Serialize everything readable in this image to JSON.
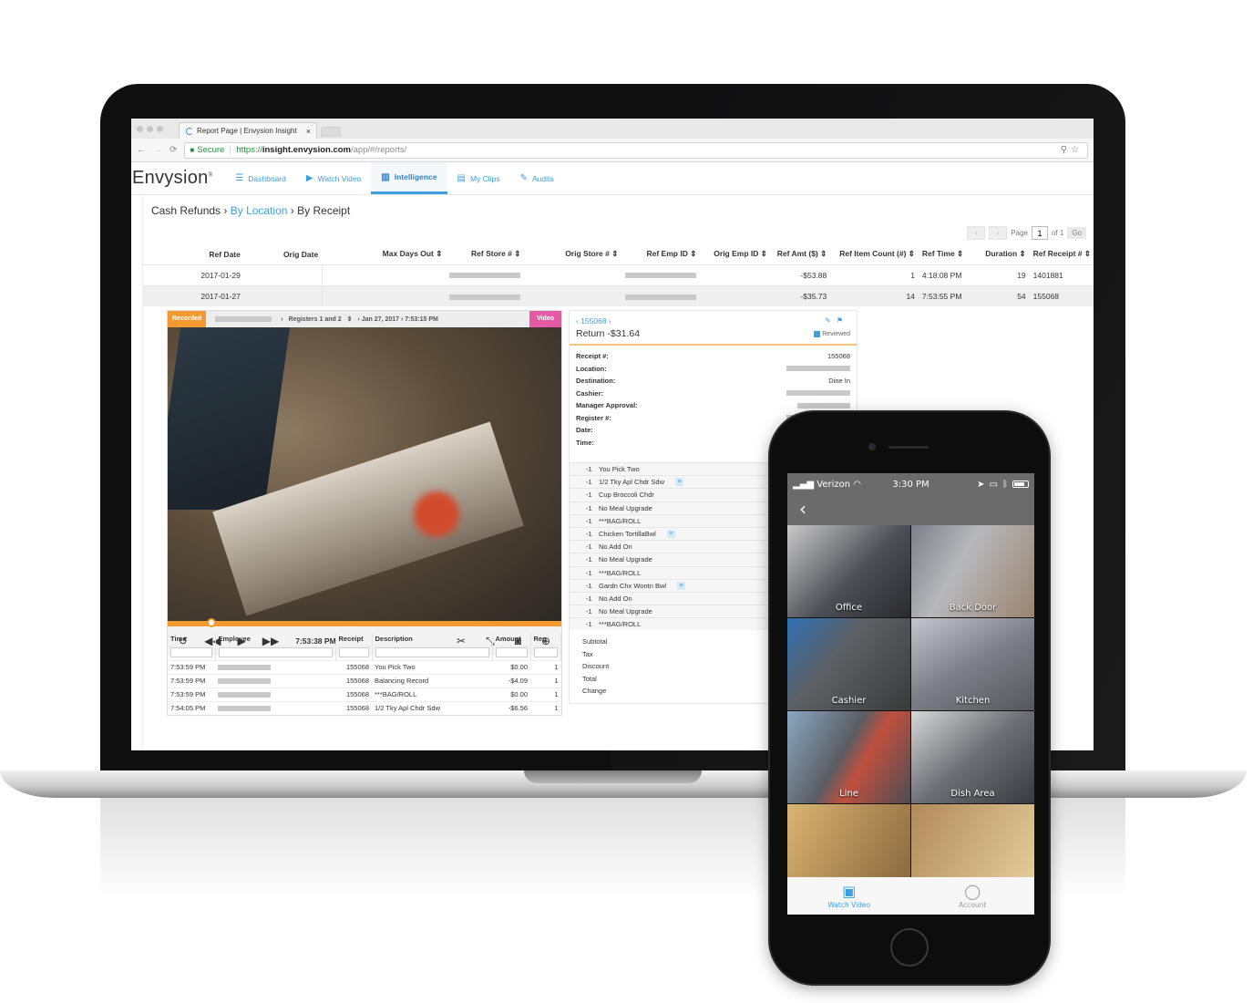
{
  "browser": {
    "tab_title": "Report Page | Envysion Insight",
    "secure_label": "Secure",
    "url_scheme": "https://",
    "url_host": "insight.envysion.com",
    "url_path": "/app/#/reports/"
  },
  "app": {
    "logo": "Envysion",
    "nav": [
      {
        "label": "Dashboard",
        "icon": "dashboard-icon"
      },
      {
        "label": "Watch Video",
        "icon": "play-circle-icon"
      },
      {
        "label": "Intelligence",
        "icon": "bar-chart-icon",
        "active": true
      },
      {
        "label": "My Clips",
        "icon": "film-icon"
      },
      {
        "label": "Audits",
        "icon": "edit-icon"
      }
    ]
  },
  "breadcrumb": {
    "root": "Cash Refunds",
    "sep": "›",
    "mid": "By Location",
    "current": "By Receipt"
  },
  "pager": {
    "page_label": "Page",
    "page": "1",
    "of": "of 1",
    "go": "Go"
  },
  "report_table": {
    "columns": [
      "Ref Date",
      "Orig Date",
      "Max Days Out",
      "Ref Store #",
      "Orig Store #",
      "Ref Emp ID",
      "Orig Emp ID",
      "Ref Amt ($)",
      "Ref Item Count (#)",
      "Ref Time",
      "Duration",
      "Ref Receipt #"
    ],
    "rows": [
      {
        "ref_date": "2017-01-29",
        "ref_amt": "-$53.88",
        "count": "1",
        "ref_time": "4:18:08 PM",
        "duration": "19",
        "receipt": "1401881"
      },
      {
        "ref_date": "2017-01-27",
        "ref_amt": "-$35.73",
        "count": "14",
        "ref_time": "7:53:55 PM",
        "duration": "54",
        "receipt": "155068"
      }
    ]
  },
  "video": {
    "recorded_badge": "Recorded",
    "registers": "Registers 1 and 2",
    "datetime": "Jan 27, 2017 › 7:53:15 PM",
    "video_badge": "Video",
    "playback_time": "7:53:38 PM",
    "progress": 0.1
  },
  "transactions": {
    "columns": [
      "Time",
      "Employee",
      "Receipt",
      "Description",
      "Amount",
      "Reg"
    ],
    "rows": [
      {
        "time": "7:53:59 PM",
        "receipt": "155068",
        "desc": "You Pick Two",
        "amount": "$0.00",
        "reg": "1"
      },
      {
        "time": "7:53:59 PM",
        "receipt": "155068",
        "desc": "Balancing Record",
        "amount": "-$4.09",
        "reg": "1"
      },
      {
        "time": "7:53:59 PM",
        "receipt": "155068",
        "desc": "***BAG/ROLL",
        "amount": "$0.00",
        "reg": "1"
      },
      {
        "time": "7:54:05 PM",
        "receipt": "155068",
        "desc": "1/2 Tky Apl Chdr Sdw",
        "amount": "-$6.56",
        "reg": "1"
      }
    ]
  },
  "receipt": {
    "number": "155068",
    "title": "Return -$31.64",
    "reviewed": "Reviewed",
    "fields": [
      {
        "k": "Receipt #:",
        "v": "155068"
      },
      {
        "k": "Location:",
        "v": ""
      },
      {
        "k": "Destination:",
        "v": "Dine In"
      },
      {
        "k": "Cashier:",
        "v": ""
      },
      {
        "k": "Manager Approval:",
        "v": ""
      },
      {
        "k": "Register #:",
        "v": ""
      },
      {
        "k": "Date:",
        "v": ""
      },
      {
        "k": "Time:",
        "v": ""
      }
    ],
    "items": [
      {
        "q": "-1",
        "d": "You Pick Two"
      },
      {
        "q": "-1",
        "d": "1/2 Tky Apl Chdr Sdw",
        "list": true
      },
      {
        "q": "-1",
        "d": "Cup Broccoli Chdr"
      },
      {
        "q": "-1",
        "d": "No Meal Upgrade"
      },
      {
        "q": "-1",
        "d": "***BAG/ROLL"
      },
      {
        "q": "-1",
        "d": "Chicken TortillaBwl",
        "list": true
      },
      {
        "q": "-1",
        "d": "No Add On"
      },
      {
        "q": "-1",
        "d": "No Meal Upgrade"
      },
      {
        "q": "-1",
        "d": "***BAG/ROLL"
      },
      {
        "q": "-1",
        "d": "Gardn Chx Wontn Bwl",
        "list": true
      },
      {
        "q": "-1",
        "d": "No Add On"
      },
      {
        "q": "-1",
        "d": "No Meal Upgrade"
      },
      {
        "q": "-1",
        "d": "***BAG/ROLL"
      }
    ],
    "totals": [
      "Subtotal",
      "Tax",
      "Discount",
      "Total",
      "Change"
    ]
  },
  "phone": {
    "carrier": "Verizon",
    "time": "3:30 PM",
    "cameras": [
      "Office",
      "Back Door",
      "Cashier",
      "Kitchen",
      "Line",
      "Dish Area",
      "",
      ""
    ],
    "tabs": [
      {
        "label": "Watch Video",
        "active": true
      },
      {
        "label": "Account"
      }
    ]
  }
}
